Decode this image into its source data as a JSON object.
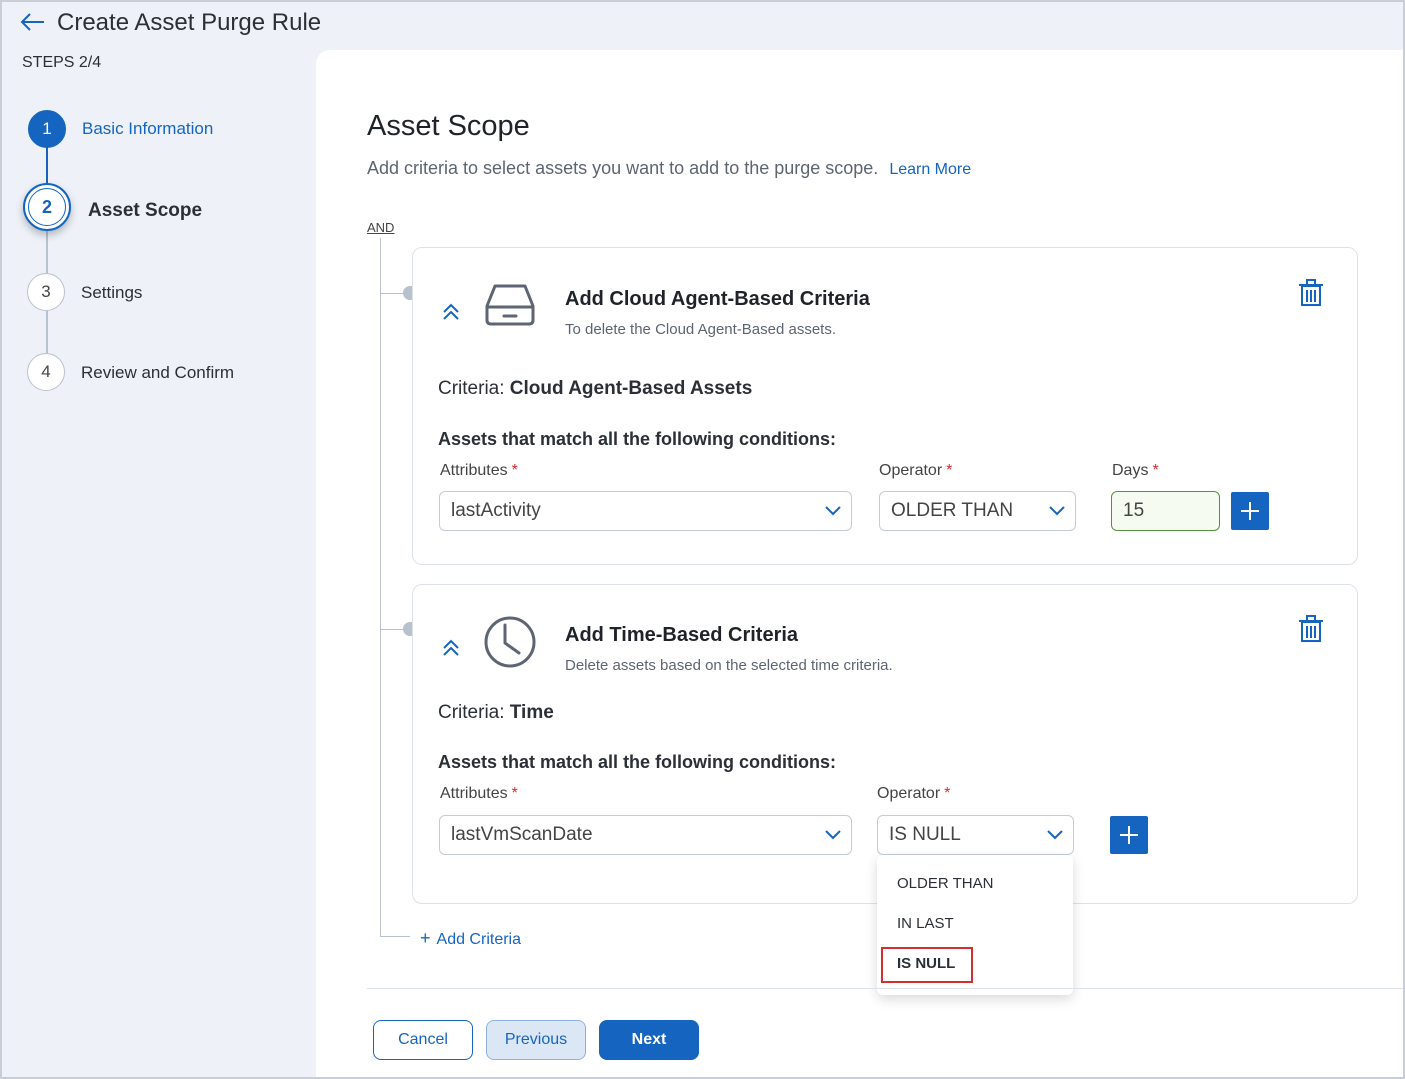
{
  "header": {
    "title": "Create Asset Purge Rule",
    "steps_counter": "STEPS 2/4"
  },
  "stepper": {
    "steps": [
      {
        "number": "1",
        "label": "Basic Information",
        "state": "done"
      },
      {
        "number": "2",
        "label": "Asset Scope",
        "state": "active"
      },
      {
        "number": "3",
        "label": "Settings",
        "state": "pending"
      },
      {
        "number": "4",
        "label": "Review and Confirm",
        "state": "pending"
      }
    ]
  },
  "main": {
    "title": "Asset Scope",
    "description": "Add criteria to select assets you want to add to the purge scope.",
    "learn_more": "Learn More",
    "logic_operator": "AND",
    "cards": [
      {
        "title": "Add Cloud Agent-Based Criteria",
        "subtitle": "To delete the Cloud Agent-Based assets.",
        "criteria_prefix": "Criteria: ",
        "criteria_value": "Cloud Agent-Based Assets",
        "conditions_title": "Assets that match all the following conditions:",
        "attributes_label": "Attributes",
        "attributes_value": "lastActivity",
        "operator_label": "Operator",
        "operator_value": "OLDER THAN",
        "days_label": "Days",
        "days_value": "15"
      },
      {
        "title": "Add Time-Based Criteria",
        "subtitle": "Delete assets based on the selected time criteria.",
        "criteria_prefix": "Criteria: ",
        "criteria_value": "Time",
        "conditions_title": "Assets that match all the following conditions:",
        "attributes_label": "Attributes",
        "attributes_value": "lastVmScanDate",
        "operator_label": "Operator",
        "operator_value": "IS NULL"
      }
    ],
    "operator_options": [
      "OLDER THAN",
      "IN LAST",
      "IS NULL"
    ],
    "add_criteria": "Add Criteria"
  },
  "footer": {
    "cancel": "Cancel",
    "previous": "Previous",
    "next": "Next"
  },
  "colors": {
    "accent": "#1565c0",
    "required": "#d32f2f",
    "highlight": "#d32f2f"
  }
}
